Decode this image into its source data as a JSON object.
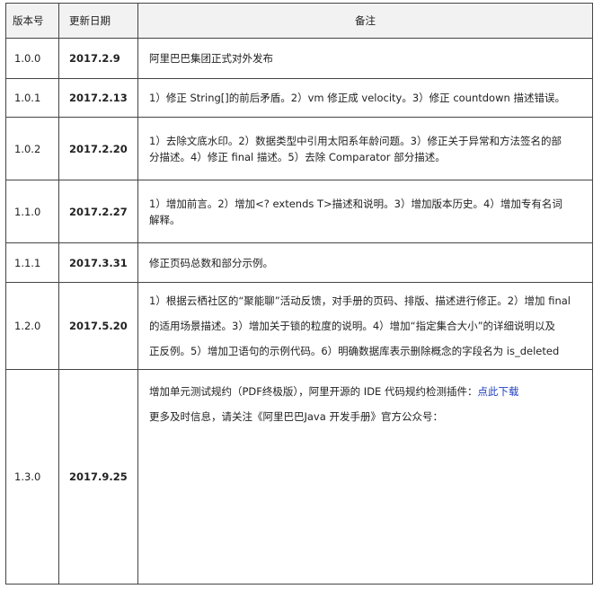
{
  "headers": {
    "version": "版本号",
    "date": "更新日期",
    "notes": "备注"
  },
  "rows": [
    {
      "version": "1.0.0",
      "date": "2017.2.9",
      "lines": [
        "阿里巴巴集团正式对外发布"
      ]
    },
    {
      "version": "1.0.1",
      "date": "2017.2.13",
      "lines": [
        "1）修正 String[]的前后矛盾。2）vm 修正成 velocity。3）修正 countdown 描述错误。"
      ]
    },
    {
      "version": "1.0.2",
      "date": "2017.2.20",
      "lines": [
        "1）去除文底水印。2）数据类型中引用太阳系年龄问题。3）修正关于异常和方法签名的部",
        "分描述。4）修正 final 描述。5）去除 Comparator 部分描述。"
      ]
    },
    {
      "version": "1.1.0",
      "date": "2017.2.27",
      "lines": [
        "1）增加前言。2）增加<? extends T>描述和说明。3）增加版本历史。4）增加专有名词",
        "解释。"
      ]
    },
    {
      "version": "1.1.1",
      "date": "2017.3.31",
      "lines": [
        "修正页码总数和部分示例。"
      ]
    },
    {
      "version": "1.2.0",
      "date": "2017.5.20",
      "lines": [
        "1）根据云栖社区的“聚能聊”活动反馈，对手册的页码、排版、描述进行修正。2）增加 final",
        "的适用场景描述。3）增加关于锁的粒度的说明。4）增加“指定集合大小”的详细说明以及",
        "正反例。5）增加卫语句的示例代码。6）明确数据库表示删除概念的字段名为 is_deleted"
      ]
    },
    {
      "version": "1.3.0",
      "date": "2017.9.25",
      "line1": "增加单元测试规约（PDF终极版），阿里开源的 IDE 代码规约检测插件：",
      "link": "点此下载",
      "line2": "更多及时信息，请关注《阿里巴巴Java 开发手册》官方公众号："
    }
  ]
}
